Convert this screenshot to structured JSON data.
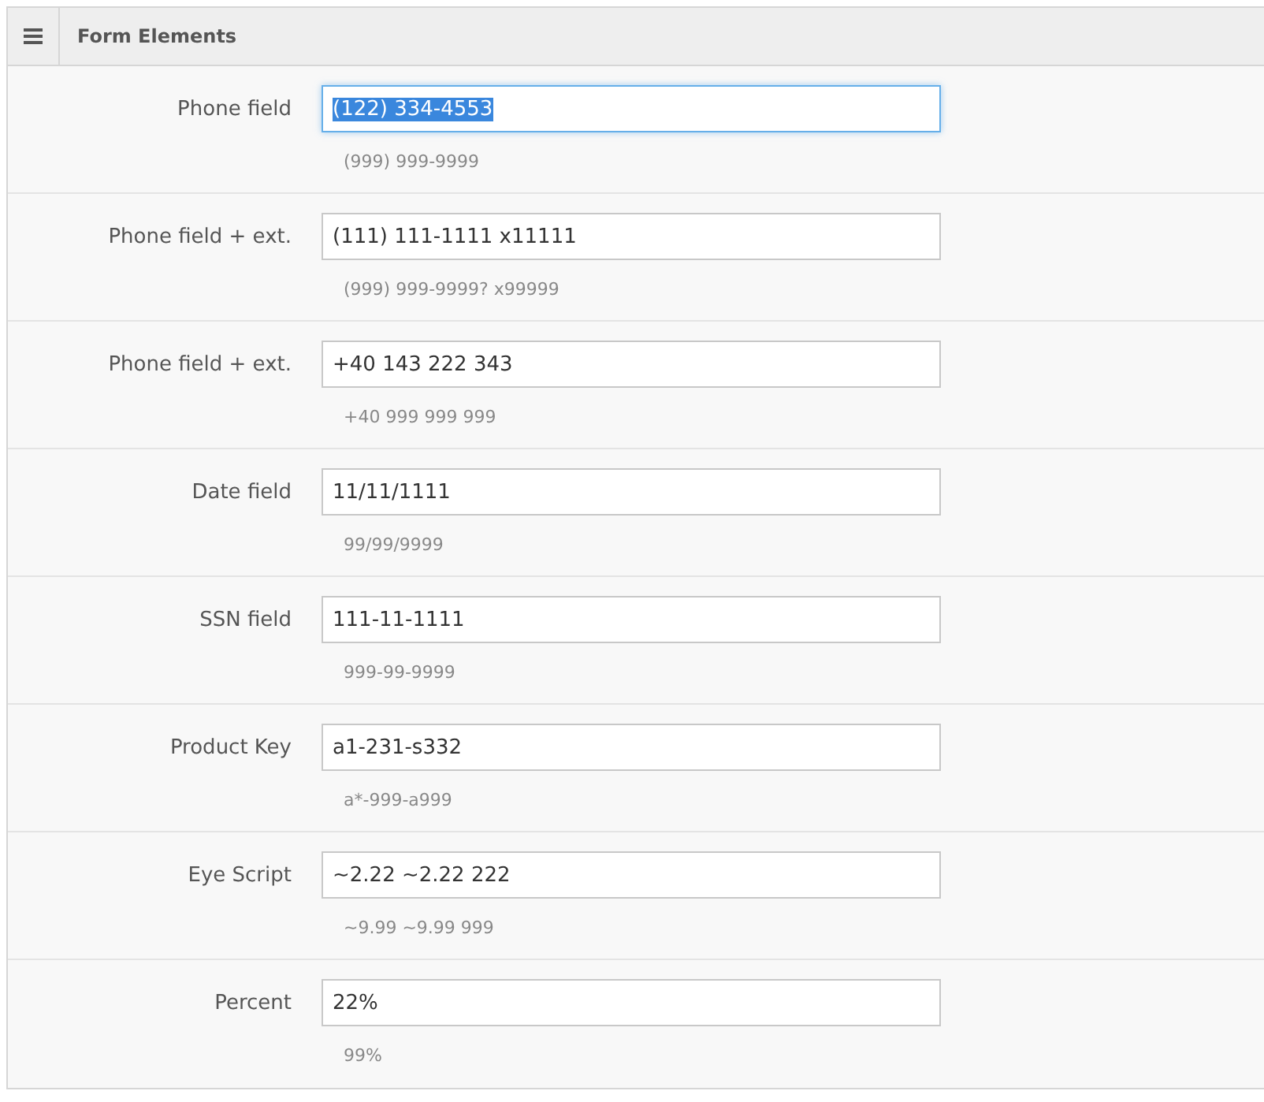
{
  "panel": {
    "title": "Form Elements"
  },
  "fields": [
    {
      "label": "Phone field",
      "value": "(122) 334-4553",
      "hint": "(999) 999-9999",
      "focused": true
    },
    {
      "label": "Phone field + ext.",
      "value": "(111) 111-1111 x11111",
      "hint": "(999) 999-9999? x99999",
      "focused": false
    },
    {
      "label": "Phone field + ext.",
      "value": "+40 143 222 343",
      "hint": "+40 999 999 999",
      "focused": false
    },
    {
      "label": "Date field",
      "value": "11/11/1111",
      "hint": "99/99/9999",
      "focused": false
    },
    {
      "label": "SSN field",
      "value": "111-11-1111",
      "hint": "999-99-9999",
      "focused": false
    },
    {
      "label": "Product Key",
      "value": "a1-231-s332",
      "hint": "a*-999-a999",
      "focused": false
    },
    {
      "label": "Eye Script",
      "value": "~2.22 ~2.22 222",
      "hint": "~9.99 ~9.99 999",
      "focused": false
    },
    {
      "label": "Percent",
      "value": "22%",
      "hint": "99%",
      "focused": false
    }
  ]
}
